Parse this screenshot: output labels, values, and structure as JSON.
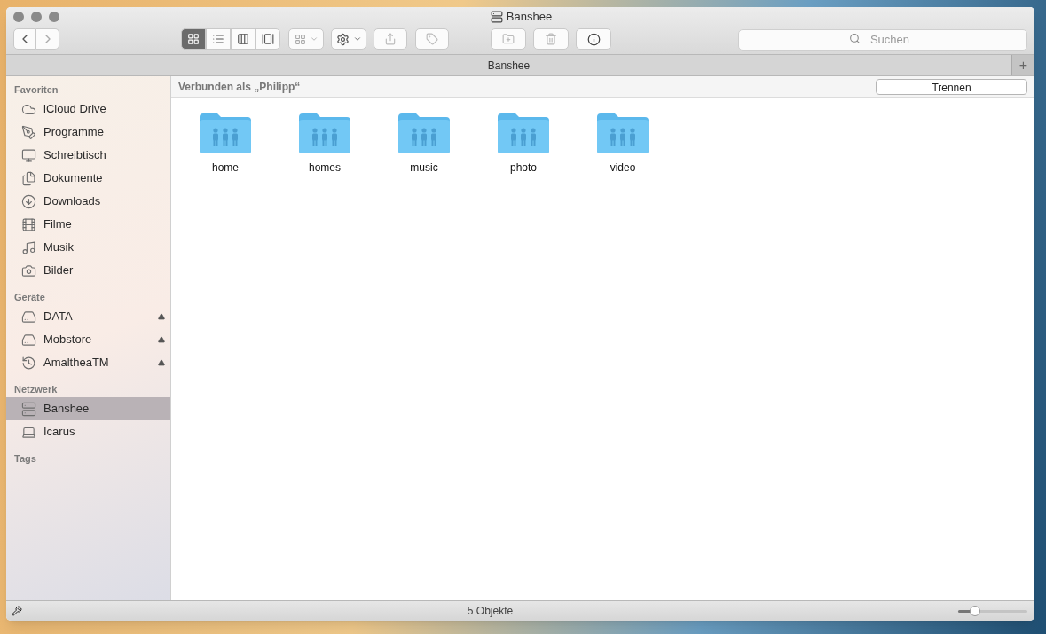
{
  "window": {
    "title": "Banshee"
  },
  "toolbar": {
    "view_modes": [
      {
        "kind": "icons",
        "selected": true
      },
      {
        "kind": "list",
        "selected": false
      },
      {
        "kind": "columns",
        "selected": false
      },
      {
        "kind": "cover",
        "selected": false
      }
    ],
    "search": {
      "placeholder": "Suchen"
    }
  },
  "path_bar": {
    "title": "Banshee",
    "add": "+"
  },
  "sidebar": {
    "sections": [
      {
        "title": "Favoriten",
        "items": [
          {
            "label": "iCloud Drive",
            "kind": "cloud",
            "selected": false
          },
          {
            "label": "Programme",
            "kind": "apps",
            "selected": false
          },
          {
            "label": "Schreibtisch",
            "kind": "desktop",
            "selected": false
          },
          {
            "label": "Dokumente",
            "kind": "documents",
            "selected": false
          },
          {
            "label": "Downloads",
            "kind": "download",
            "selected": false
          },
          {
            "label": "Filme",
            "kind": "film",
            "selected": false
          },
          {
            "label": "Musik",
            "kind": "music",
            "selected": false
          },
          {
            "label": "Bilder",
            "kind": "camera",
            "selected": false
          }
        ]
      },
      {
        "title": "Geräte",
        "items": [
          {
            "label": "DATA",
            "kind": "disk",
            "selected": false,
            "ejectable": true
          },
          {
            "label": "Mobstore",
            "kind": "disk",
            "selected": false,
            "ejectable": true
          },
          {
            "label": "AmaltheaTM",
            "kind": "timemachine",
            "selected": false,
            "ejectable": true
          }
        ]
      },
      {
        "title": "Netzwerk",
        "items": [
          {
            "label": "Banshee",
            "kind": "server",
            "selected": true
          },
          {
            "label": "Icarus",
            "kind": "laptop",
            "selected": false
          }
        ]
      },
      {
        "title": "Tags"
      }
    ]
  },
  "connection_bar": {
    "text": "Verbunden als „Philipp“",
    "button": "Trennen"
  },
  "folders": [
    {
      "name": "home"
    },
    {
      "name": "homes"
    },
    {
      "name": "music"
    },
    {
      "name": "photo"
    },
    {
      "name": "video"
    }
  ],
  "status_bar": {
    "text": "5 Objekte",
    "icon_size": {
      "level": 0.24
    }
  }
}
